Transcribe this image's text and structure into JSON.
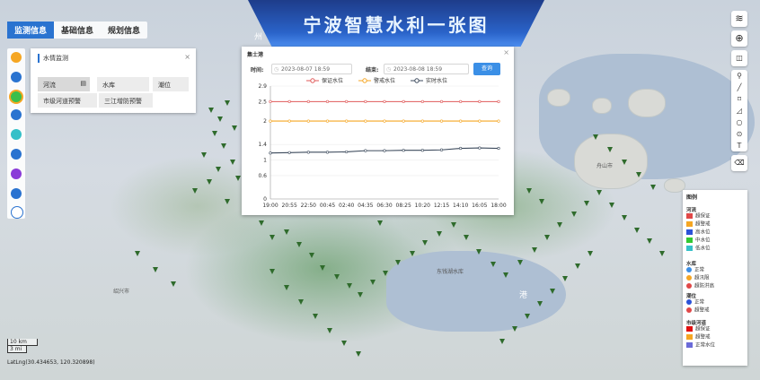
{
  "app": {
    "title": "宁波智慧水利一张图"
  },
  "top_tabs": [
    "监测信息",
    "基础信息",
    "规划信息"
  ],
  "panel": {
    "title": "水情监测",
    "close": "×",
    "items": [
      "河流",
      "水库",
      "潮位",
      "市级河道预警",
      "三江增防预警"
    ]
  },
  "chart_window": {
    "station": "集士港",
    "close": "×",
    "time_label": "时间:",
    "start_value": "2023-08-07 18:59",
    "end_label": "结束:",
    "end_value": "2023-08-08 18:59",
    "query_button": "查询"
  },
  "chart_data": {
    "type": "line",
    "x": [
      "19:00",
      "20:55",
      "22:50",
      "00:45",
      "02:40",
      "04:35",
      "06:30",
      "08:25",
      "10:20",
      "12:15",
      "14:10",
      "16:05",
      "18:00"
    ],
    "ylim": [
      0,
      2.9
    ],
    "yticks": [
      "0",
      "0.6",
      "1",
      "1.4",
      "2",
      "2.5",
      "2.9"
    ],
    "series": [
      {
        "name": "保证水位",
        "color": "#e05a5a",
        "values": [
          2.5,
          2.5,
          2.5,
          2.5,
          2.5,
          2.5,
          2.5,
          2.5,
          2.5,
          2.5,
          2.5,
          2.5,
          2.5
        ]
      },
      {
        "name": "警戒水位",
        "color": "#f5a623",
        "values": [
          2.0,
          2.0,
          2.0,
          2.0,
          2.0,
          2.0,
          2.0,
          2.0,
          2.0,
          2.0,
          2.0,
          2.0,
          2.0
        ]
      },
      {
        "name": "实时水位",
        "color": "#3c4a5c",
        "values": [
          1.18,
          1.19,
          1.2,
          1.2,
          1.21,
          1.24,
          1.24,
          1.25,
          1.25,
          1.26,
          1.3,
          1.31,
          1.3
        ]
      }
    ]
  },
  "map_labels": {
    "place_1": "舟山市",
    "place_2": "绍兴市",
    "place_3": "东钱湖水库",
    "place_4": "港",
    "place_5": "州",
    "scale_km": "10 km",
    "scale_mi": "3 mi",
    "latlng": "LatLng(30.434653, 120.320898)"
  },
  "legend": {
    "title": "图例",
    "river_title": "河流",
    "river_items": [
      {
        "label": "超保证",
        "color": "#e04848"
      },
      {
        "label": "超警戒",
        "color": "#f5a623"
      },
      {
        "label": "高水位",
        "color": "#2b52d8"
      },
      {
        "label": "中水位",
        "color": "#32c832"
      },
      {
        "label": "低水位",
        "color": "#35c0c8"
      }
    ],
    "reservoir_title": "水库",
    "reservoir_items": [
      {
        "label": "正常",
        "color": "#3b8fe6"
      },
      {
        "label": "超汛限",
        "color": "#f5a623"
      },
      {
        "label": "超防洪高",
        "color": "#e04848"
      }
    ],
    "tide_title": "潮位",
    "tide_items": [
      {
        "label": "正常",
        "color": "#2b52d8"
      },
      {
        "label": "超警戒",
        "color": "#e04848"
      }
    ],
    "city_river_title": "市级河道",
    "city_river_items": [
      {
        "label": "超保证",
        "color": "#e01010"
      },
      {
        "label": "超警戒",
        "color": "#f5a623"
      },
      {
        "label": "正常水位",
        "color": "#6b6bd8"
      }
    ]
  },
  "right_tools": [
    "layers-icon",
    "globe-icon",
    "stack-icon",
    "pin-icon",
    "line-icon",
    "rect-icon",
    "polygon-icon",
    "circle-icon",
    "point-icon",
    "text-icon",
    "eraser-icon"
  ]
}
